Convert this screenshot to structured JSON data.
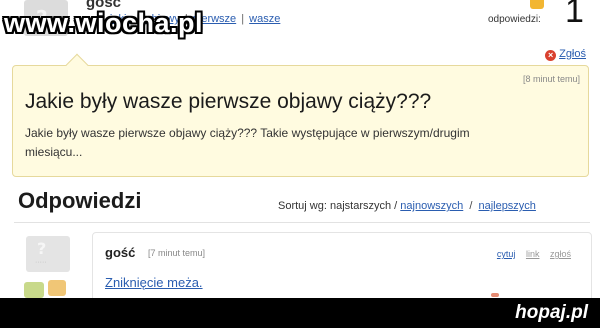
{
  "watermark_top": "www.wiocha.pl",
  "question": {
    "author": "gość",
    "tags": [
      "jakie",
      "objawy",
      "pierwsze",
      "wasze"
    ],
    "answers_label": "odpowiedzi:",
    "answers_count": "1",
    "report_label": "Zgłoś",
    "time": "[8 minut temu]",
    "title": "Jakie były wasze pierwsze objawy ciąży???",
    "body": "Jakie były wasze pierwsze objawy ciąży??? Takie występujące w pierwszym/drugim miesiącu..."
  },
  "answers": {
    "heading": "Odpowiedzi",
    "sort_prefix": "Sortuj wg: najstarszych /",
    "sort_newest": "najnowszych",
    "sort_sep": "/",
    "sort_best": "najlepszych"
  },
  "reply": {
    "author": "gość",
    "time": "[7 minut temu]",
    "quote_label": "cytuj",
    "link_label": "link",
    "report_label": "zgłoś",
    "text": "Zniknięcie meża."
  },
  "footer": {
    "brand": "hopaj.pl"
  },
  "colors": {
    "link": "#2a5db0",
    "question_bg": "#fffbe0",
    "footer_bg": "#000000"
  },
  "icons": {
    "report": "report-x-icon",
    "avatar": "question-mark-avatar-icon",
    "thumb_up": "thumb-up-icon",
    "thumb_down": "thumb-down-icon"
  }
}
